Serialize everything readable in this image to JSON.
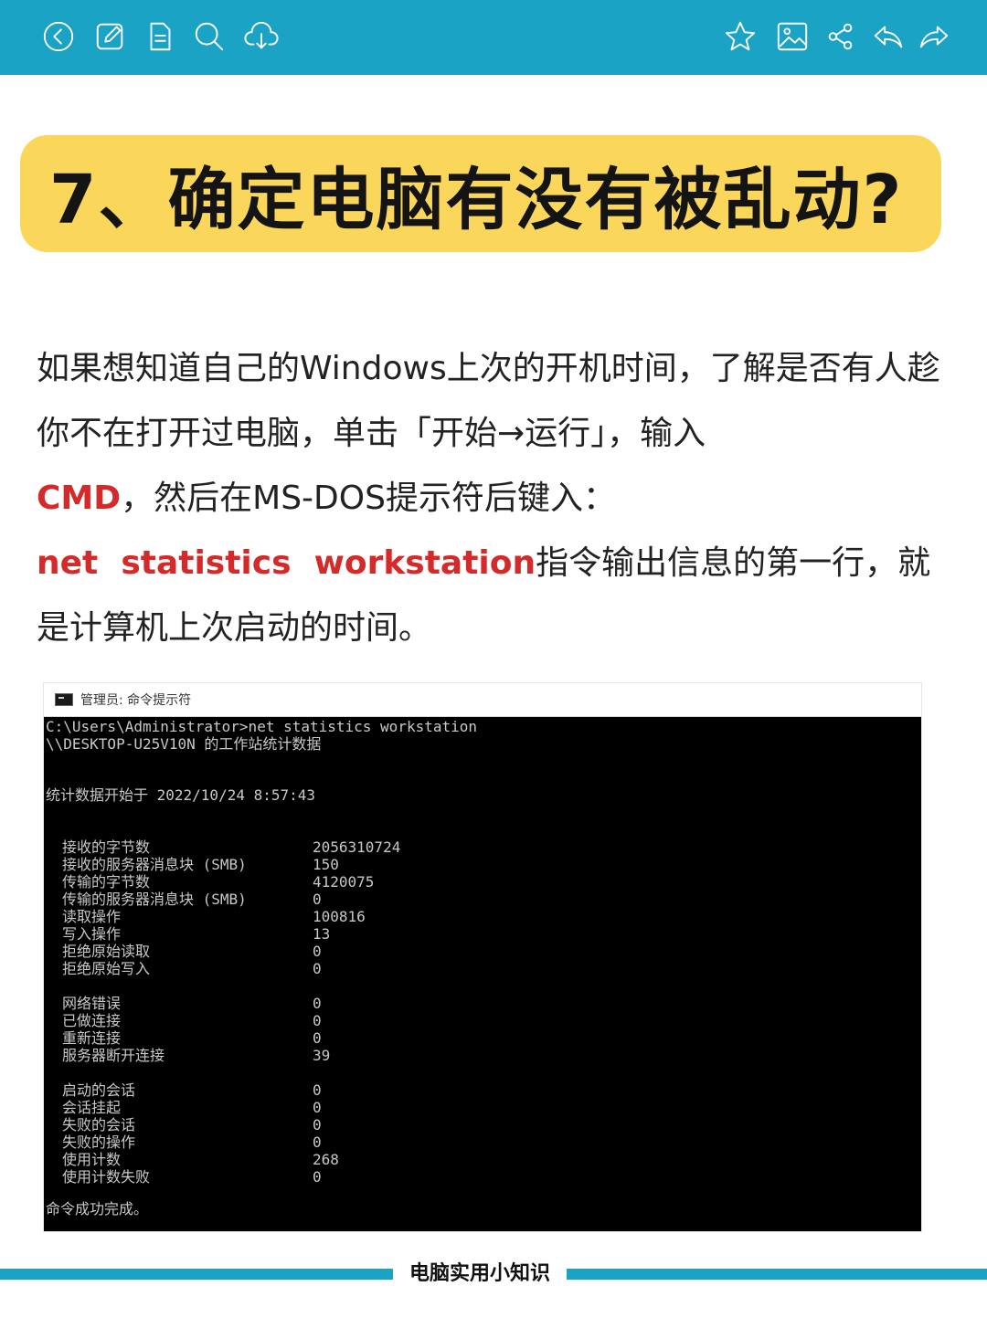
{
  "toolbar": {
    "left_icons": [
      "back-icon",
      "edit-icon",
      "document-icon",
      "search-icon",
      "download-icon"
    ],
    "right_icons": [
      "star-icon",
      "image-icon",
      "share-icon",
      "reply-icon",
      "forward-icon"
    ],
    "background_color": "#1ba3c6"
  },
  "title": {
    "text": "7、确定电脑有没有被乱动?",
    "background_color": "#fad75b"
  },
  "article": {
    "p1": "如果想知道自己的Windows上次的开机时间，了解是否有人趁你不在打开过电脑，单击「开始→运行」，输入",
    "cmd_keyword": "CMD",
    "p1_tail": "，然后在MS-DOS提示符后键入：",
    "command_keyword": "net  statistics  workstation",
    "p2_tail": "指令输出信息的第一行，就是计算机上次启动的时间。",
    "highlight_color": "#d42a2a"
  },
  "console": {
    "window_title": "管理员: 命令提示符",
    "prompt_line": "C:\\Users\\Administrator>net statistics workstation",
    "header_line": "\\\\DESKTOP-U25V10N 的工作站统计数据",
    "start_line": "统计数据开始于 2022/10/24 8:57:43",
    "stats_group1": [
      {
        "label": "接收的字节数",
        "value": "2056310724"
      },
      {
        "label": "接收的服务器消息块 (SMB)",
        "value": "150"
      },
      {
        "label": "传输的字节数",
        "value": "4120075"
      },
      {
        "label": "传输的服务器消息块 (SMB)",
        "value": "0"
      },
      {
        "label": "读取操作",
        "value": "100816"
      },
      {
        "label": "写入操作",
        "value": "13"
      },
      {
        "label": "拒绝原始读取",
        "value": "0"
      },
      {
        "label": "拒绝原始写入",
        "value": "0"
      }
    ],
    "stats_group2": [
      {
        "label": "网络错误",
        "value": "0"
      },
      {
        "label": "已做连接",
        "value": "0"
      },
      {
        "label": "重新连接",
        "value": "0"
      },
      {
        "label": "服务器断开连接",
        "value": "39"
      }
    ],
    "stats_group3": [
      {
        "label": "启动的会话",
        "value": "0"
      },
      {
        "label": "会话挂起",
        "value": "0"
      },
      {
        "label": "失败的会话",
        "value": "0"
      },
      {
        "label": "失败的操作",
        "value": "0"
      },
      {
        "label": "使用计数",
        "value": "268"
      },
      {
        "label": "使用计数失败",
        "value": "0"
      }
    ],
    "done_line": "命令成功完成。"
  },
  "footer": {
    "text": "电脑实用小知识"
  }
}
